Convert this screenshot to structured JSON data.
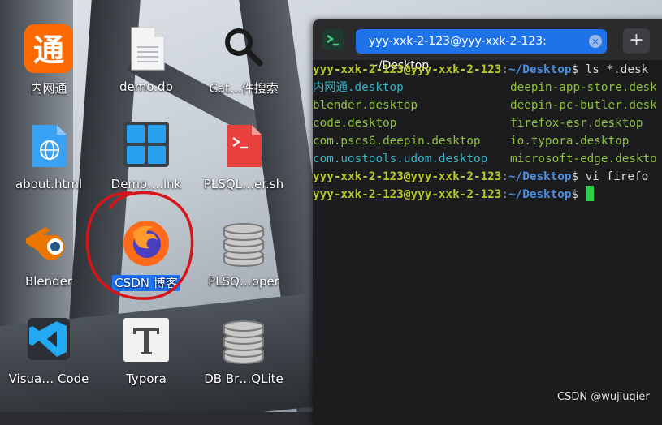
{
  "desktop": {
    "icons": [
      {
        "name": "内网通",
        "icon": "neiwangtong-app-icon"
      },
      {
        "name": "demo.db",
        "icon": "document-icon"
      },
      {
        "name": "Cat…件搜索",
        "icon": "search-magnifier-icon"
      },
      {
        "name": "about.html",
        "icon": "html-file-icon"
      },
      {
        "name": "Demo….lnk",
        "icon": "windows-shortcut-icon"
      },
      {
        "name": "PLSQL…er.sh",
        "icon": "shell-script-icon"
      },
      {
        "name": "Blender",
        "icon": "blender-icon"
      },
      {
        "name": "CSDN 博客",
        "icon": "firefox-icon",
        "selected": true
      },
      {
        "name": "PLSQ…oper",
        "icon": "database-icon"
      },
      {
        "name": "Visua… Code",
        "icon": "vscode-icon"
      },
      {
        "name": "Typora",
        "icon": "typora-icon"
      },
      {
        "name": "DB Br…QLite",
        "icon": "database-icon"
      }
    ]
  },
  "terminal": {
    "tab_title": "yyy-xxk-2-123@yyy-xxk-2-123: ~/Desktop",
    "new_tab_symbol": "+",
    "close_symbol": "×",
    "prompt_user": "yyy-xxk-2-123@yyy-xxk-2-123",
    "prompt_sep": ":",
    "prompt_path": "~/Desktop",
    "prompt_end": "$ ",
    "commands": [
      "ls *.desk",
      "vi firefo"
    ],
    "listing": [
      [
        "内网通",
        ".desktop",
        "deepin-app-store.desk"
      ],
      [
        "blender.desktop",
        "",
        "deepin-pc-butler.desk"
      ],
      [
        "code.desktop",
        "",
        "firefox-esr.desktop"
      ],
      [
        "com.pscs6.deepin.desktop",
        "",
        "io.typora.desktop"
      ],
      [
        "com.uostools.udom.desktop",
        "",
        "microsoft-edge.deskto"
      ]
    ]
  },
  "watermark": "CSDN @wujiuqier",
  "colors": {
    "accent": "#1e73e8",
    "prompt_user": "#b6c72a",
    "prompt_path": "#4b8fe0",
    "cursor": "#29d04a",
    "annotation": "#d8141a"
  }
}
